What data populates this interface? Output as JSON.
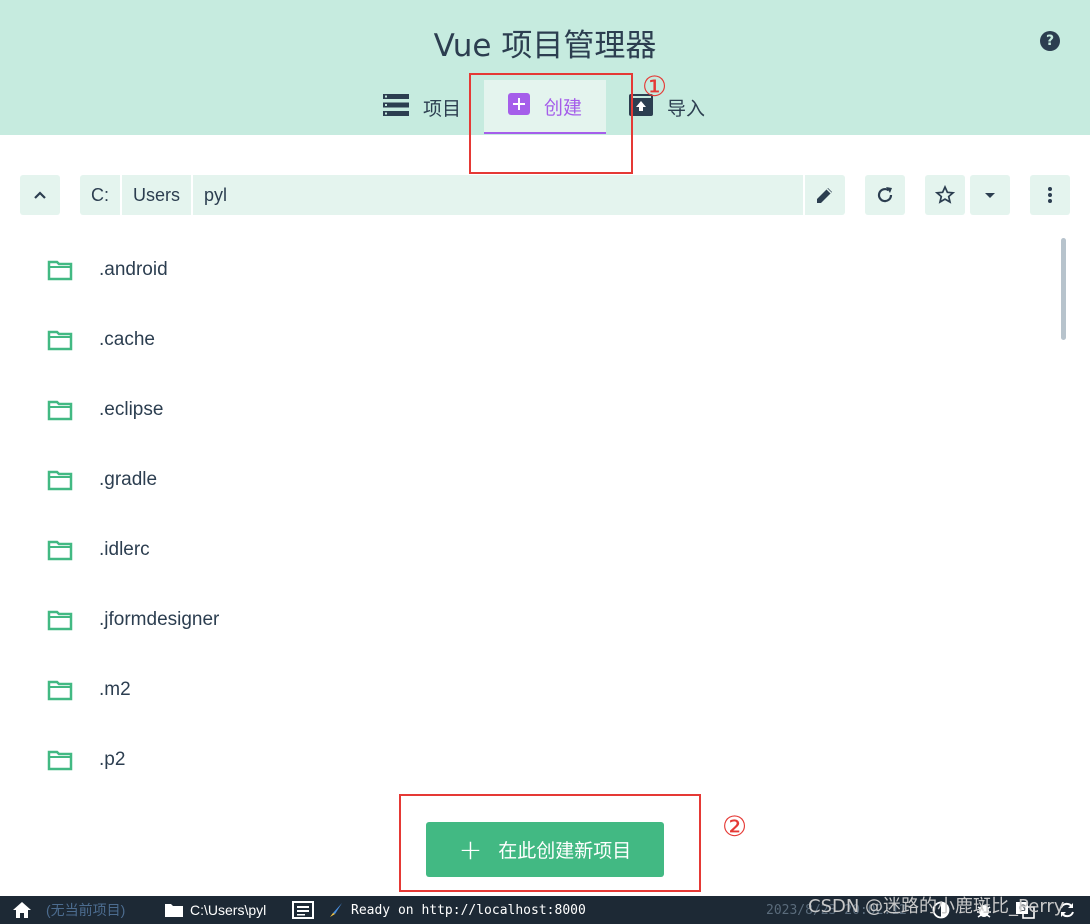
{
  "header": {
    "title": "Vue 项目管理器",
    "help_icon": "help-icon",
    "tabs": [
      {
        "label": "项目",
        "icon": "list-icon",
        "active": false
      },
      {
        "label": "创建",
        "icon": "plus-box-icon",
        "active": true
      },
      {
        "label": "导入",
        "icon": "upload-icon",
        "active": false
      }
    ]
  },
  "annotations": {
    "mark1": "①",
    "mark2": "②"
  },
  "pathbar": {
    "crumbs": [
      "C:",
      "Users",
      "pyl"
    ]
  },
  "folders": [
    ".android",
    ".cache",
    ".eclipse",
    ".gradle",
    ".idlerc",
    ".jformdesigner",
    ".m2",
    ".p2"
  ],
  "create_button": {
    "label": "在此创建新项目"
  },
  "statusbar": {
    "no_project": "(无当前项目)",
    "cwd": "C:\\Users\\pyl",
    "log": "Ready on http://localhost:8000",
    "time": "2023/8/23 20:02:12"
  },
  "watermark": "CSDN @迷路的小鹿斑比_Perry",
  "colors": {
    "header_bg": "#c6ebdf",
    "accent_green": "#42b983",
    "accent_purple": "#a55eea",
    "statusbar_bg": "#1d2935",
    "annotation_red": "#e53935"
  }
}
